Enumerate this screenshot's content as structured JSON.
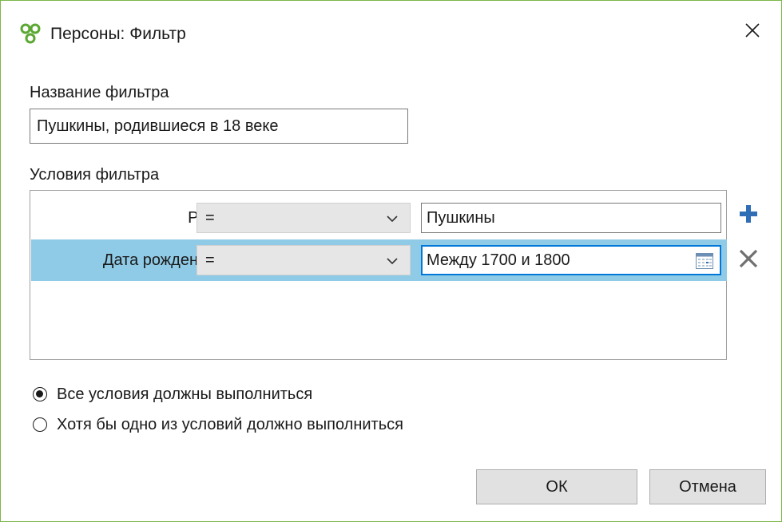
{
  "window": {
    "title": "Персоны: Фильтр",
    "app_icon": "genealogy-tree-icon",
    "accent_color": "#7ab648"
  },
  "filter_name": {
    "label": "Название фильтра",
    "value": "Пушкины, родившиеся в 18 веке"
  },
  "conditions": {
    "label": "Условия фильтра",
    "rows": [
      {
        "field": "Род",
        "operator": "=",
        "value": "Пушкины",
        "selected": false
      },
      {
        "field": "Дата рождения",
        "operator": "=",
        "value": "Между 1700 и 1800",
        "selected": true
      }
    ],
    "selected_row_color": "#8fcbe6"
  },
  "match_mode": {
    "options": [
      {
        "label": "Все условия должны выполниться",
        "checked": true
      },
      {
        "label": "Хотя бы одно из условий должно выполниться",
        "checked": false
      }
    ]
  },
  "buttons": {
    "ok": "ОК",
    "cancel": "Отмена"
  }
}
